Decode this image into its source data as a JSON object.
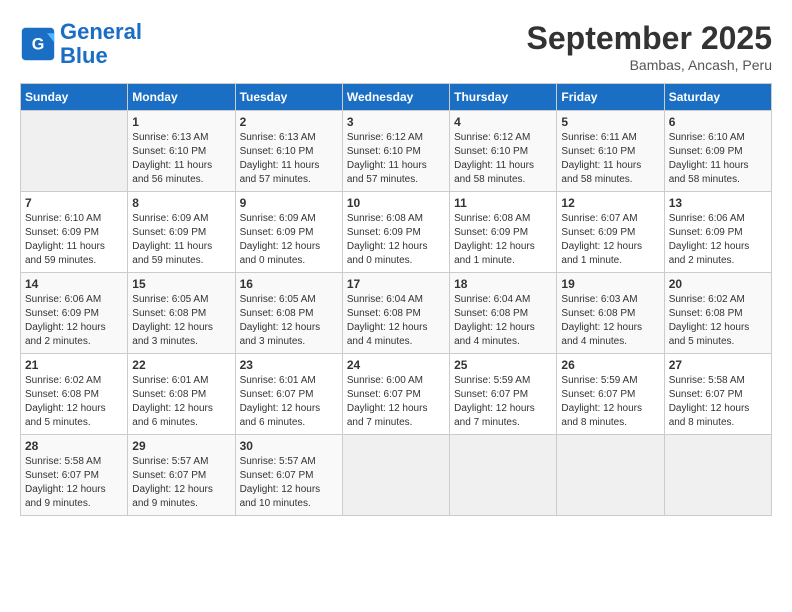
{
  "header": {
    "logo_line1": "General",
    "logo_line2": "Blue",
    "month": "September 2025",
    "location": "Bambas, Ancash, Peru"
  },
  "days_of_week": [
    "Sunday",
    "Monday",
    "Tuesday",
    "Wednesday",
    "Thursday",
    "Friday",
    "Saturday"
  ],
  "weeks": [
    [
      {
        "day": "",
        "empty": true
      },
      {
        "day": "1",
        "sunrise": "6:13 AM",
        "sunset": "6:10 PM",
        "daylight": "11 hours and 56 minutes."
      },
      {
        "day": "2",
        "sunrise": "6:13 AM",
        "sunset": "6:10 PM",
        "daylight": "11 hours and 57 minutes."
      },
      {
        "day": "3",
        "sunrise": "6:12 AM",
        "sunset": "6:10 PM",
        "daylight": "11 hours and 57 minutes."
      },
      {
        "day": "4",
        "sunrise": "6:12 AM",
        "sunset": "6:10 PM",
        "daylight": "11 hours and 58 minutes."
      },
      {
        "day": "5",
        "sunrise": "6:11 AM",
        "sunset": "6:10 PM",
        "daylight": "11 hours and 58 minutes."
      },
      {
        "day": "6",
        "sunrise": "6:10 AM",
        "sunset": "6:09 PM",
        "daylight": "11 hours and 58 minutes."
      }
    ],
    [
      {
        "day": "7",
        "sunrise": "6:10 AM",
        "sunset": "6:09 PM",
        "daylight": "11 hours and 59 minutes."
      },
      {
        "day": "8",
        "sunrise": "6:09 AM",
        "sunset": "6:09 PM",
        "daylight": "11 hours and 59 minutes."
      },
      {
        "day": "9",
        "sunrise": "6:09 AM",
        "sunset": "6:09 PM",
        "daylight": "12 hours and 0 minutes."
      },
      {
        "day": "10",
        "sunrise": "6:08 AM",
        "sunset": "6:09 PM",
        "daylight": "12 hours and 0 minutes."
      },
      {
        "day": "11",
        "sunrise": "6:08 AM",
        "sunset": "6:09 PM",
        "daylight": "12 hours and 1 minute."
      },
      {
        "day": "12",
        "sunrise": "6:07 AM",
        "sunset": "6:09 PM",
        "daylight": "12 hours and 1 minute."
      },
      {
        "day": "13",
        "sunrise": "6:06 AM",
        "sunset": "6:09 PM",
        "daylight": "12 hours and 2 minutes."
      }
    ],
    [
      {
        "day": "14",
        "sunrise": "6:06 AM",
        "sunset": "6:09 PM",
        "daylight": "12 hours and 2 minutes."
      },
      {
        "day": "15",
        "sunrise": "6:05 AM",
        "sunset": "6:08 PM",
        "daylight": "12 hours and 3 minutes."
      },
      {
        "day": "16",
        "sunrise": "6:05 AM",
        "sunset": "6:08 PM",
        "daylight": "12 hours and 3 minutes."
      },
      {
        "day": "17",
        "sunrise": "6:04 AM",
        "sunset": "6:08 PM",
        "daylight": "12 hours and 4 minutes."
      },
      {
        "day": "18",
        "sunrise": "6:04 AM",
        "sunset": "6:08 PM",
        "daylight": "12 hours and 4 minutes."
      },
      {
        "day": "19",
        "sunrise": "6:03 AM",
        "sunset": "6:08 PM",
        "daylight": "12 hours and 4 minutes."
      },
      {
        "day": "20",
        "sunrise": "6:02 AM",
        "sunset": "6:08 PM",
        "daylight": "12 hours and 5 minutes."
      }
    ],
    [
      {
        "day": "21",
        "sunrise": "6:02 AM",
        "sunset": "6:08 PM",
        "daylight": "12 hours and 5 minutes."
      },
      {
        "day": "22",
        "sunrise": "6:01 AM",
        "sunset": "6:08 PM",
        "daylight": "12 hours and 6 minutes."
      },
      {
        "day": "23",
        "sunrise": "6:01 AM",
        "sunset": "6:07 PM",
        "daylight": "12 hours and 6 minutes."
      },
      {
        "day": "24",
        "sunrise": "6:00 AM",
        "sunset": "6:07 PM",
        "daylight": "12 hours and 7 minutes."
      },
      {
        "day": "25",
        "sunrise": "5:59 AM",
        "sunset": "6:07 PM",
        "daylight": "12 hours and 7 minutes."
      },
      {
        "day": "26",
        "sunrise": "5:59 AM",
        "sunset": "6:07 PM",
        "daylight": "12 hours and 8 minutes."
      },
      {
        "day": "27",
        "sunrise": "5:58 AM",
        "sunset": "6:07 PM",
        "daylight": "12 hours and 8 minutes."
      }
    ],
    [
      {
        "day": "28",
        "sunrise": "5:58 AM",
        "sunset": "6:07 PM",
        "daylight": "12 hours and 9 minutes."
      },
      {
        "day": "29",
        "sunrise": "5:57 AM",
        "sunset": "6:07 PM",
        "daylight": "12 hours and 9 minutes."
      },
      {
        "day": "30",
        "sunrise": "5:57 AM",
        "sunset": "6:07 PM",
        "daylight": "12 hours and 10 minutes."
      },
      {
        "day": "",
        "empty": true
      },
      {
        "day": "",
        "empty": true
      },
      {
        "day": "",
        "empty": true
      },
      {
        "day": "",
        "empty": true
      }
    ]
  ]
}
